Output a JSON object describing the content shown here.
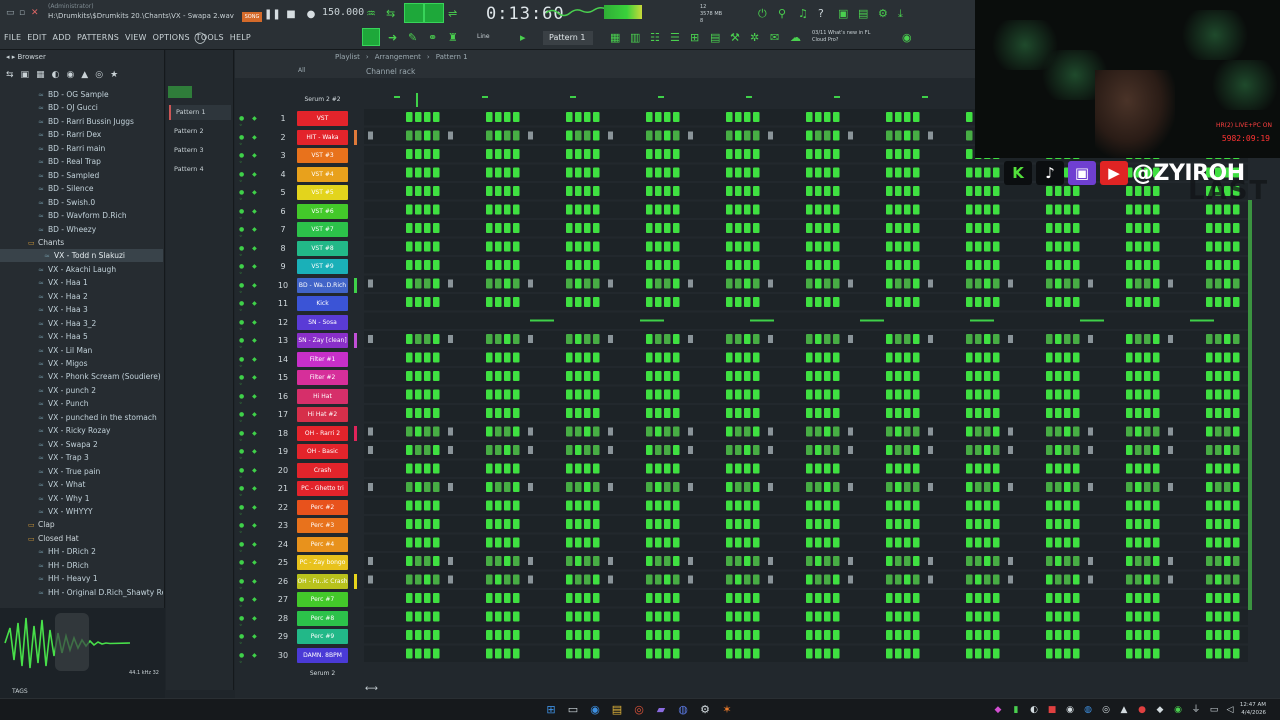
{
  "title": {
    "admin": "(Administrator)",
    "path": "H:\\Drumkits\\$Drumkits 20.\\Chants\\VX - Swapa 2.wav"
  },
  "toolbar": {
    "song_label": "SONG",
    "tempo": "150.000",
    "time": "0:13:60",
    "cpu_line1": "12",
    "cpu_line2": "3578 MB",
    "cpu_line3": "8"
  },
  "menu": [
    "FILE",
    "EDIT",
    "ADD",
    "PATTERNS",
    "VIEW",
    "OPTIONS",
    "TOOLS",
    "HELP"
  ],
  "mode": "Line",
  "pattern_selector": "Pattern 1",
  "news": {
    "line1": "03/11  What's new in FL",
    "line2": "Cloud Pro?"
  },
  "browser": {
    "title": "Browser",
    "items": [
      {
        "label": "BD - OG Sample",
        "type": "file"
      },
      {
        "label": "BD - OJ Gucci",
        "type": "file"
      },
      {
        "label": "BD - Rarri Bussin Juggs",
        "type": "file"
      },
      {
        "label": "BD - Rarri Dex",
        "type": "file"
      },
      {
        "label": "BD - Rarri main",
        "type": "file"
      },
      {
        "label": "BD - Real Trap",
        "type": "file"
      },
      {
        "label": "BD - Sampled",
        "type": "file"
      },
      {
        "label": "BD - Silence",
        "type": "file"
      },
      {
        "label": "BD - Swish.0",
        "type": "file"
      },
      {
        "label": "BD - Wavform D.Rich",
        "type": "file"
      },
      {
        "label": "BD - Wheezy",
        "type": "file"
      },
      {
        "label": "Chants",
        "type": "folder"
      },
      {
        "label": "VX - Todd n Slakuzi",
        "type": "selected"
      },
      {
        "label": "VX - Akachi Laugh",
        "type": "file"
      },
      {
        "label": "VX - Haa 1",
        "type": "file"
      },
      {
        "label": "VX - Haa 2",
        "type": "file"
      },
      {
        "label": "VX - Haa 3",
        "type": "file"
      },
      {
        "label": "VX - Haa 3_2",
        "type": "file"
      },
      {
        "label": "VX - Haa 5",
        "type": "file"
      },
      {
        "label": "VX - Lil Man",
        "type": "file"
      },
      {
        "label": "VX - Migos",
        "type": "file"
      },
      {
        "label": "VX - Phonk Scream (Soudiere)",
        "type": "file"
      },
      {
        "label": "VX - punch 2",
        "type": "file"
      },
      {
        "label": "VX - Punch",
        "type": "file"
      },
      {
        "label": "VX - punched in the stomach",
        "type": "file"
      },
      {
        "label": "VX - Ricky Rozay",
        "type": "file"
      },
      {
        "label": "VX - Swapa 2",
        "type": "file"
      },
      {
        "label": "VX - Trap 3",
        "type": "file"
      },
      {
        "label": "VX - True pain",
        "type": "file"
      },
      {
        "label": "VX - What",
        "type": "file"
      },
      {
        "label": "VX - Why 1",
        "type": "file"
      },
      {
        "label": "VX - WHYYY",
        "type": "file"
      },
      {
        "label": "Clap",
        "type": "folder"
      },
      {
        "label": "Closed Hat",
        "type": "folder"
      },
      {
        "label": "HH - DRich 2",
        "type": "file"
      },
      {
        "label": "HH - DRich",
        "type": "file"
      },
      {
        "label": "HH - Heavy 1",
        "type": "file"
      },
      {
        "label": "HH - Original D.Rich_Shawty Redd",
        "type": "file"
      }
    ],
    "wave_info": "44.1 kHz 32",
    "tags_label": "TAGS"
  },
  "patterns": [
    "Pattern 1",
    "Pattern 2",
    "Pattern 3",
    "Pattern 4"
  ],
  "rack": {
    "breadcrumb": [
      "Playlist",
      "Arrangement",
      "Pattern 1"
    ],
    "title": "Channel rack",
    "all_label": "All",
    "serum_top": "Serum 2 #2",
    "serum_bottom": "Serum 2",
    "channels": [
      {
        "num": "1",
        "name": "VST",
        "color": "#e3242b",
        "bar": "",
        "type": "midi"
      },
      {
        "num": "2",
        "name": "HIT - Waka",
        "color": "#e3242b",
        "bar": "#e07a3a",
        "type": "sparse"
      },
      {
        "num": "3",
        "name": "VST #3",
        "color": "#e8721c",
        "bar": "",
        "type": "midi"
      },
      {
        "num": "4",
        "name": "VST #4",
        "color": "#e8a11c",
        "bar": "",
        "type": "midi"
      },
      {
        "num": "5",
        "name": "VST #5",
        "color": "#e3d41c",
        "bar": "",
        "type": "midi"
      },
      {
        "num": "6",
        "name": "VST #6",
        "color": "#43c92a",
        "bar": "",
        "type": "midi"
      },
      {
        "num": "7",
        "name": "VST #7",
        "color": "#2cc24a",
        "bar": "",
        "type": "midi"
      },
      {
        "num": "8",
        "name": "VST #8",
        "color": "#22b888",
        "bar": "",
        "type": "midi"
      },
      {
        "num": "9",
        "name": "VST #9",
        "color": "#1ab0b8",
        "bar": "",
        "type": "midi"
      },
      {
        "num": "10",
        "name": "BD - Wa..D.Rich",
        "color": "#4164c8",
        "bar": "#3fd149",
        "type": "sparse"
      },
      {
        "num": "11",
        "name": "Kick",
        "color": "#3b54d6",
        "bar": "",
        "type": "midi"
      },
      {
        "num": "12",
        "name": "SN - Sosa",
        "color": "#5a3bd6",
        "bar": "",
        "type": "line"
      },
      {
        "num": "13",
        "name": "SN - Zay [clean]",
        "color": "#8a2fc9",
        "bar": "#c14fd6",
        "type": "sparse"
      },
      {
        "num": "14",
        "name": "Filter #1",
        "color": "#c72fc9",
        "bar": "",
        "type": "midi"
      },
      {
        "num": "15",
        "name": "Filter #2",
        "color": "#d62f9a",
        "bar": "",
        "type": "midi"
      },
      {
        "num": "16",
        "name": "Hi Hat",
        "color": "#d62f6a",
        "bar": "",
        "type": "midi"
      },
      {
        "num": "17",
        "name": "Hi Hat #2",
        "color": "#d62f4a",
        "bar": "",
        "type": "midi"
      },
      {
        "num": "18",
        "name": "OH - Rarri 2",
        "color": "#e3242b",
        "bar": "#e0245a",
        "type": "sparse"
      },
      {
        "num": "19",
        "name": "OH - Basic",
        "color": "#e3242b",
        "bar": "",
        "type": "sparse"
      },
      {
        "num": "20",
        "name": "Crash",
        "color": "#e3242b",
        "bar": "",
        "type": "midi"
      },
      {
        "num": "21",
        "name": "PC - Ghetto tri",
        "color": "#e3242b",
        "bar": "",
        "type": "sparse"
      },
      {
        "num": "22",
        "name": "Perc #2",
        "color": "#e8521c",
        "bar": "",
        "type": "midi"
      },
      {
        "num": "23",
        "name": "Perc #3",
        "color": "#e8721c",
        "bar": "",
        "type": "midi"
      },
      {
        "num": "24",
        "name": "Perc #4",
        "color": "#e8921c",
        "bar": "",
        "type": "midi"
      },
      {
        "num": "25",
        "name": "PC - Zay bongo",
        "color": "#e8c21c",
        "bar": "",
        "type": "sparse"
      },
      {
        "num": "26",
        "name": "OH - Fu..ic Crash",
        "color": "#b8c21c",
        "bar": "#e8d41c",
        "type": "sparse"
      },
      {
        "num": "27",
        "name": "Perc #7",
        "color": "#43c92a",
        "bar": "",
        "type": "midi"
      },
      {
        "num": "28",
        "name": "Perc #8",
        "color": "#2cc24a",
        "bar": "",
        "type": "midi"
      },
      {
        "num": "29",
        "name": "Perc #9",
        "color": "#22b888",
        "bar": "",
        "type": "midi"
      },
      {
        "num": "30",
        "name": "DAMN. 8BPM",
        "color": "#4a3ad6",
        "bar": "",
        "type": "midi"
      }
    ]
  },
  "overlay": {
    "handle": "@ZYIROH",
    "live_label_1": "HR(2) LIVE+PC ON",
    "live_timer": "5982:09:19",
    "last_text": "LAST"
  },
  "clock": {
    "time": "12:47 AM",
    "date": "4/4/2026"
  }
}
